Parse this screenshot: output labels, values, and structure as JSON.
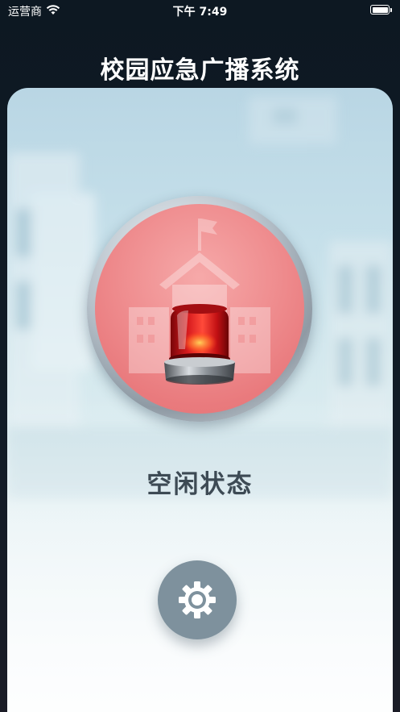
{
  "status_bar": {
    "carrier": "运营商",
    "time": "下午 7:49",
    "wifi_icon": "wifi-icon",
    "battery_icon": "battery-icon"
  },
  "header": {
    "title": "校园应急广播系统"
  },
  "alarm": {
    "icon": "siren-beacon-icon",
    "background_icon": "school-building-icon",
    "state_label": "空闲状态"
  },
  "settings": {
    "icon": "gear-icon"
  },
  "colors": {
    "background_dark": "#0d1822",
    "card_top": "#b9d6e4",
    "card_bottom": "#f7fafc",
    "alarm_red": "#e97a7d",
    "settings_button": "#7e919d",
    "state_text": "#3d4a54"
  }
}
